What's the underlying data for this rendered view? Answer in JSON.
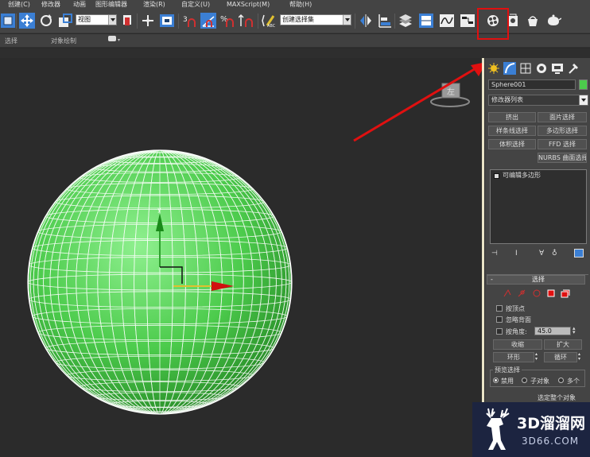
{
  "menu": {
    "create": "创建(C)",
    "modifiers": "修改器",
    "animation": "动画",
    "graph_editors": "图形编辑器",
    "rendering": "渲染(R)",
    "customize": "自定义(U)",
    "maxscript": "MAXScript(M)",
    "help": "帮助(H)"
  },
  "toolbar": {
    "ref_coord_value": "视图",
    "selection_set_value": "创建选择集",
    "snap_3": "3",
    "percent": "%"
  },
  "ribbon": {
    "select": "选择",
    "object_paint": "对象绘制"
  },
  "viewport": {
    "viewcube_face": "左",
    "axis_y": "y"
  },
  "panel": {
    "object_name": "Sphere001",
    "object_color": "#4ccb4c",
    "modifier_list": "修改器列表",
    "buttons": [
      {
        "label": "挤出"
      },
      {
        "label": "面片选择"
      },
      {
        "label": "样条线选择"
      },
      {
        "label": "多边形选择"
      },
      {
        "label": "体积选择"
      },
      {
        "label": "FFD 选择"
      },
      {
        "label": "NURBS 曲面选择"
      }
    ],
    "stack_item": "可编辑多边形",
    "rollout_title": "选择",
    "by_vertex": "按顶点",
    "ignore_backfacing": "忽略背面",
    "by_angle": "按角度:",
    "angle_value": "45.0",
    "shrink": "收缩",
    "grow": "扩大",
    "ring": "环形",
    "loop": "循环",
    "preview_selection": "预览选择",
    "disabled": "禁用",
    "subobject": "子对象",
    "multi": "多个",
    "select_whole": "选定整个对象"
  },
  "watermark": {
    "line1": "3D溜溜网",
    "line2": "3D66.COM"
  },
  "colors": {
    "sphere": "#4ccb4c",
    "highlight": "#e01010",
    "accent_blue": "#3b7fd4"
  }
}
